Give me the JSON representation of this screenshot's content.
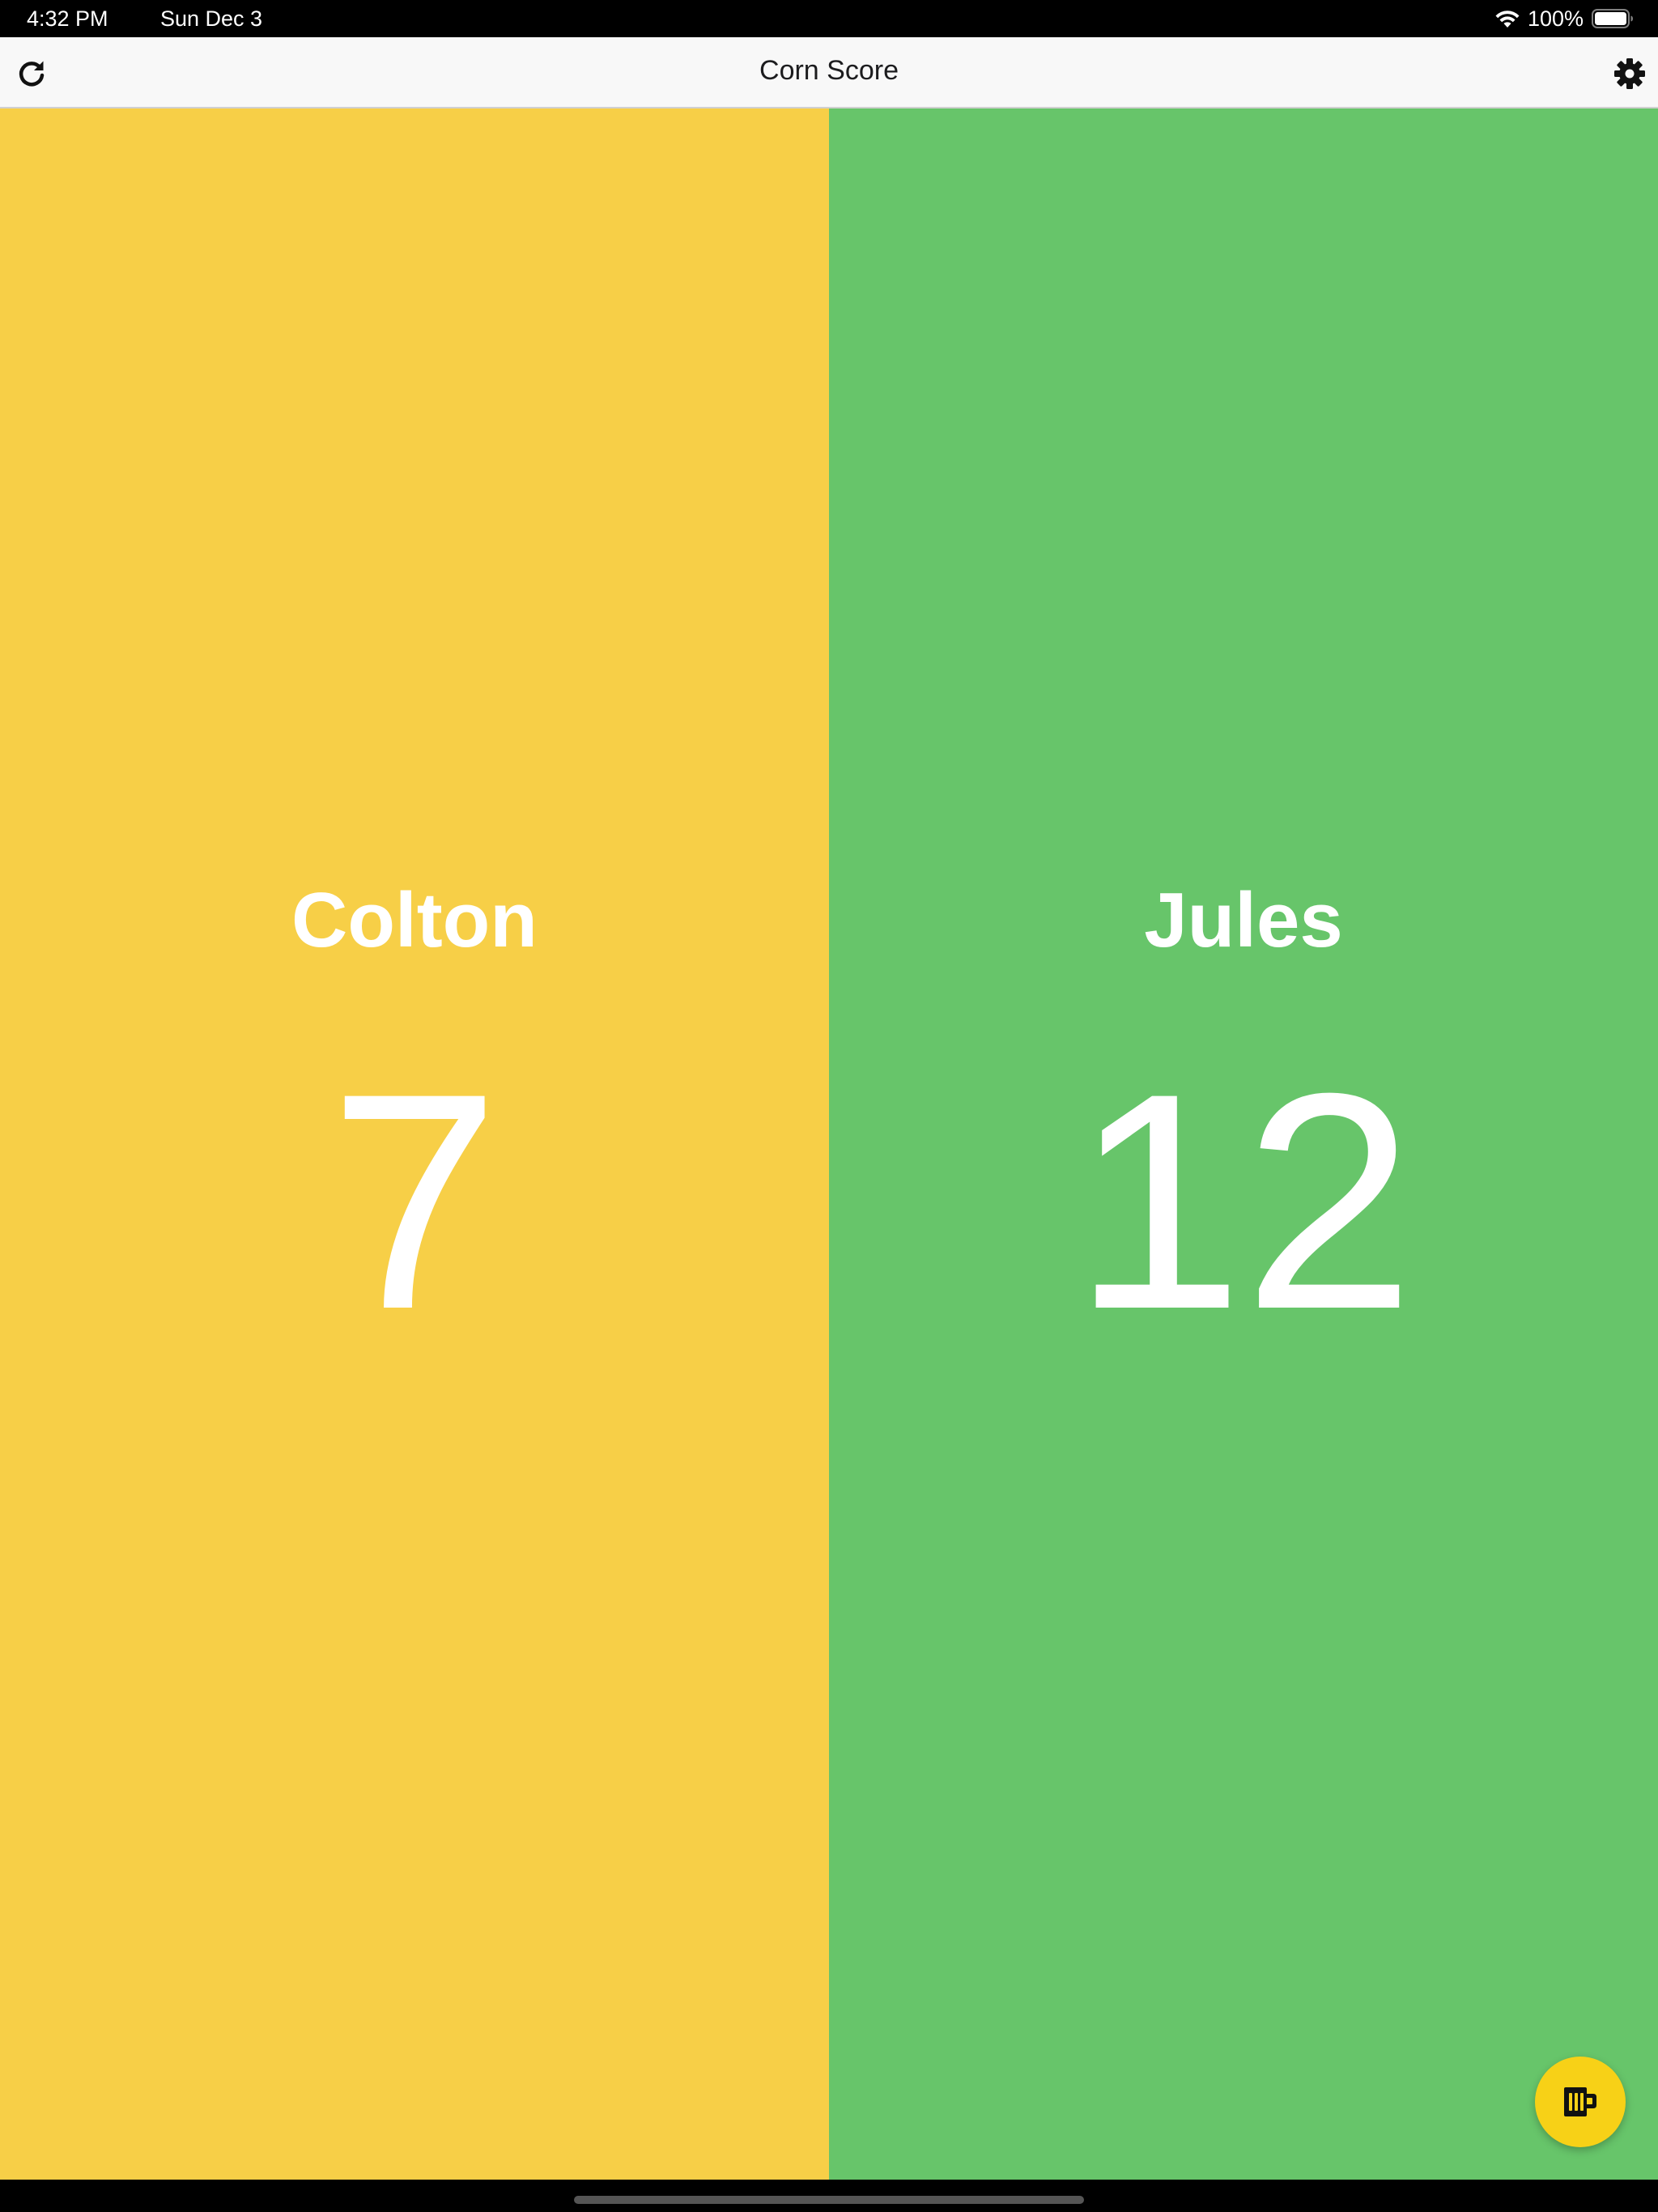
{
  "status_bar": {
    "time": "4:32 PM",
    "date": "Sun Dec 3",
    "battery_percent": "100%",
    "wifi_icon": "wifi-icon",
    "battery_icon": "battery-icon",
    "battery_level": 1.0
  },
  "nav": {
    "title": "Corn Score",
    "refresh_icon": "refresh-icon",
    "settings_icon": "gear-icon"
  },
  "players": [
    {
      "name": "Colton",
      "score": "7",
      "color": "#f7cf47"
    },
    {
      "name": "Jules",
      "score": "12",
      "color": "#67c56a"
    }
  ],
  "fab": {
    "icon": "beer-mug-icon",
    "color": "#f7d117"
  }
}
